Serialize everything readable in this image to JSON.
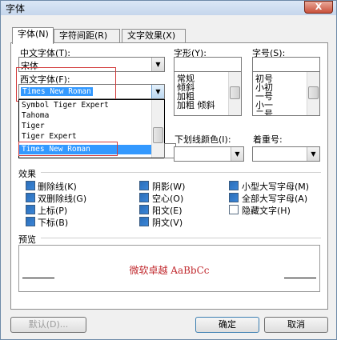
{
  "window": {
    "title": "字体",
    "close_label": "X"
  },
  "tabs": [
    "字体(N)",
    "字符间距(R)",
    "文字效果(X)"
  ],
  "chinese_font": {
    "label": "中文字体(T):",
    "value": "宋体"
  },
  "style": {
    "label": "字形(Y):",
    "value": "",
    "options": [
      "常规",
      "倾斜",
      "加粗",
      "加粗 倾斜"
    ]
  },
  "size": {
    "label": "字号(S):",
    "value": "",
    "options": [
      "初号",
      "小初",
      "一号",
      "小一",
      "二号"
    ]
  },
  "western_font": {
    "label": "西文字体(F):",
    "value": "Times New Roman"
  },
  "western_dropdown": {
    "options": [
      "Symbol Tiger Expert",
      "Tahoma",
      "Tiger",
      "Tiger Expert",
      "Times New Roman"
    ],
    "selected_index": 4
  },
  "underline_color": {
    "label": "下划线颜色(I):"
  },
  "emphasis": {
    "label": "着重号:"
  },
  "effects": {
    "label": "效果",
    "items": [
      {
        "label": "删除线(K)",
        "checked": false
      },
      {
        "label": "双删除线(G)",
        "checked": false
      },
      {
        "label": "上标(P)",
        "checked": false
      },
      {
        "label": "下标(B)",
        "checked": false
      },
      {
        "label": "阴影(W)",
        "checked": false
      },
      {
        "label": "空心(O)",
        "checked": false
      },
      {
        "label": "阳文(E)",
        "checked": false
      },
      {
        "label": "阴文(V)",
        "checked": false
      },
      {
        "label": "小型大写字母(M)",
        "checked": false
      },
      {
        "label": "全部大写字母(A)",
        "checked": false
      },
      {
        "label": "隐藏文字(H)",
        "checked": false
      }
    ]
  },
  "preview": {
    "label": "预览",
    "sample": "微软卓越 AaBbCc"
  },
  "buttons": {
    "default": "默认(D)...",
    "ok": "确定",
    "cancel": "取消"
  },
  "colors": {
    "accent": "#3399ff",
    "preview_text": "#c0282d",
    "annotation": "#d23a3a"
  }
}
